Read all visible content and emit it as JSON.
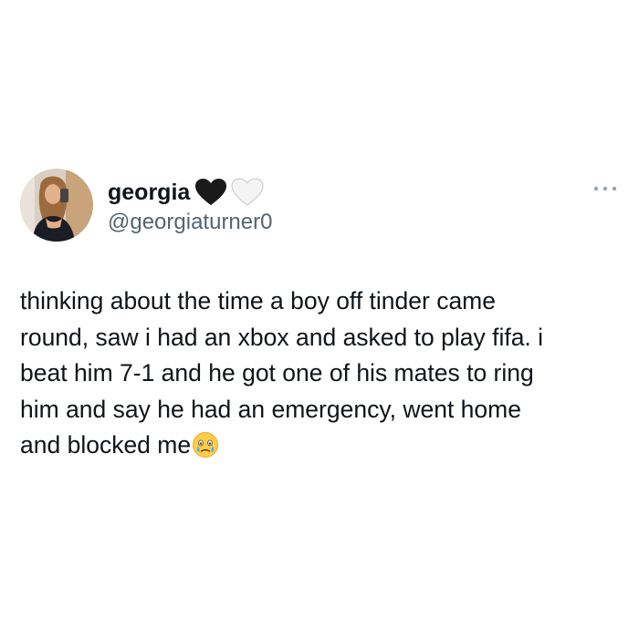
{
  "tweet": {
    "author": {
      "display_name": "georgia",
      "handle": "@georgiaturner0",
      "name_emojis": [
        "black-heart-icon",
        "white-heart-icon"
      ],
      "avatar": "profile-photo"
    },
    "menu_icon": "more-dots-icon",
    "text_lines": [
      "thinking about the time a boy off tinder came",
      "round, saw i had an xbox and asked to play fifa. i",
      "beat him 7-1 and he got one of his mates to ring",
      "him and say he had an emergency, went home",
      "and blocked me"
    ],
    "trailing_emoji": "face-holding-back-tears-icon"
  }
}
